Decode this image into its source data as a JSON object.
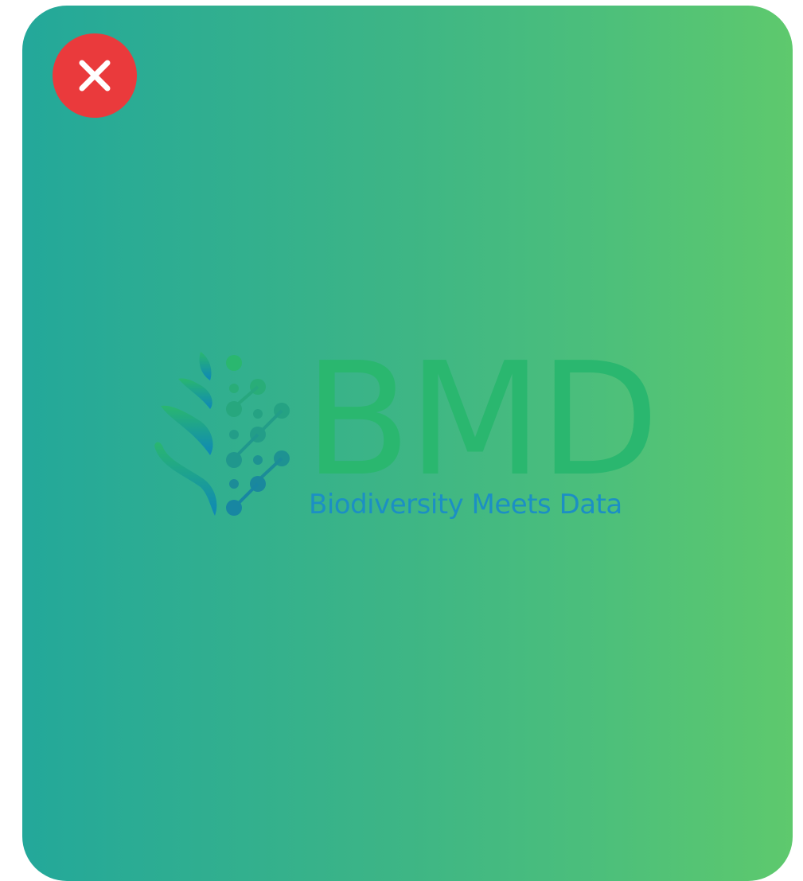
{
  "logo": {
    "letters": "BMD",
    "tagline": "Biodiversity Meets Data"
  },
  "close_button": {
    "icon": "close-icon"
  },
  "colors": {
    "gradient_start": "#23a89a",
    "gradient_end": "#5ec96d",
    "close_button_bg": "#ea3a3c",
    "logo_green": "#2ab76f",
    "logo_blue": "#1c8fc4"
  }
}
